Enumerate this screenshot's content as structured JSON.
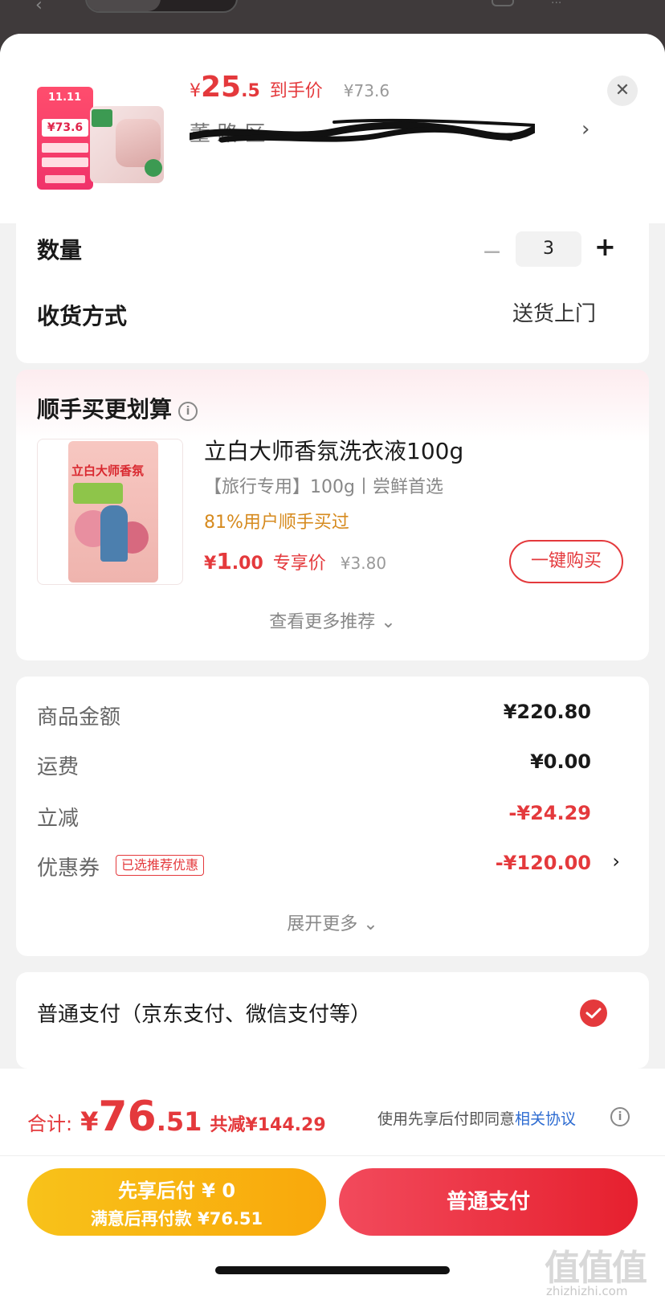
{
  "header": {
    "price_symbol": "¥",
    "price_int": "25",
    "price_dec": ".5",
    "price_tag": "到手价",
    "orig_price": "¥73.6",
    "address_visible": "董  路  区",
    "close_icon": "close-icon",
    "product_thumb_texts": {
      "event": "11.11",
      "price": "¥73.6"
    }
  },
  "quantity": {
    "label": "数量",
    "minus": "−",
    "value": "3",
    "plus": "+"
  },
  "shipping": {
    "label": "收货方式",
    "value": "送货上门"
  },
  "recommend": {
    "title": "顺手买更划算",
    "item": {
      "name": "立白大师香氛洗衣液100g",
      "sub": "【旅行专用】100g丨尝鲜首选",
      "percent": "81%用户顺手买过",
      "price_symbol": "¥",
      "price_int": "1",
      "price_dec": ".00",
      "price_tag": "专享价",
      "orig_price": "¥3.80",
      "buy_label": "一键购买",
      "image_brand": "立白大师香氛"
    },
    "more_label": "查看更多推荐 ⌄"
  },
  "summary": {
    "rows": [
      {
        "label": "商品金额",
        "value": "¥220.80"
      },
      {
        "label": "运费",
        "value": "¥0.00"
      },
      {
        "label": "立减",
        "value": "-¥24.29"
      },
      {
        "label": "优惠券",
        "value": "-¥120.00",
        "badge": "已选推荐优惠"
      }
    ],
    "expand_label": "展开更多 ⌄"
  },
  "payment": {
    "label": "普通支付（京东支付、微信支付等）"
  },
  "footer": {
    "total_label": "合计:",
    "total_symbol": "¥",
    "total_int": "76",
    "total_dec": ".51",
    "saved": "共减¥144.29",
    "agree_text": "使用先享后付即同意",
    "agree_link": "相关协议",
    "later_line1": "先享后付 ¥ 0",
    "later_line2": "满意后再付款 ¥76.51",
    "normal_label": "普通支付"
  },
  "watermark": {
    "glyphs": "值值值",
    "site": "zhizhizhi.com"
  },
  "colors": {
    "accent": "#e4393c",
    "orange": "#d68a1e",
    "yellow": "#f8c21a",
    "link": "#2c6bd1"
  }
}
